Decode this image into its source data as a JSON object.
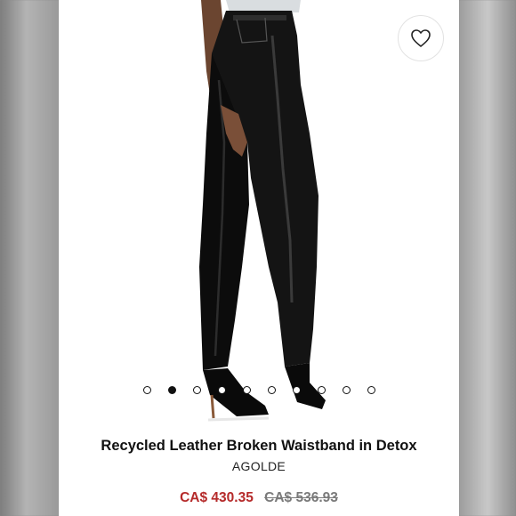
{
  "product": {
    "title": "Recycled Leather Broken Waistband in Detox",
    "brand": "AGOLDE",
    "sale_price": "CA$ 430.35",
    "original_price": "CA$ 536.93"
  },
  "carousel": {
    "total_images": 10,
    "active_index": 1
  },
  "icons": {
    "favorite": "heart-outline-icon"
  },
  "colors": {
    "sale_price": "#b52a2a",
    "original_price": "#7a7a7a",
    "text": "#111111"
  }
}
